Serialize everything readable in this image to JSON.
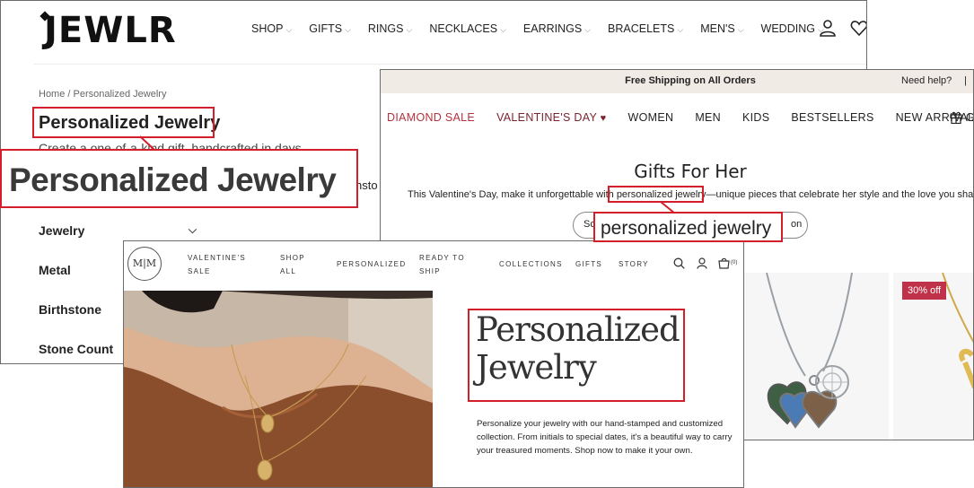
{
  "jewlr": {
    "logo": "JEWLR",
    "nav": [
      "SHOP",
      "GIFTS",
      "RINGS",
      "NECKLACES",
      "EARRINGS",
      "BRACELETS",
      "MEN'S",
      "WEDDING"
    ],
    "breadcrumb": "Home / Personalized Jewelry",
    "title": "Personalized Jewelry",
    "subtitle": "Create a one-of-a-kind gift, handcrafted in days",
    "button_fragment": "hsto",
    "filters": [
      "Jewelry",
      "Metal",
      "Birthstone",
      "Stone Count"
    ],
    "zoom_text": "Personalized Jewelry"
  },
  "gifts_site": {
    "shipping": "Free Shipping on All Orders",
    "help": "Need help?",
    "help_sep": "|",
    "nav": [
      "DIAMOND SALE",
      "VALENTINE'S DAY",
      "WOMEN",
      "MEN",
      "KIDS",
      "BESTSELLERS",
      "NEW ARRIVALS"
    ],
    "nav_fragment": "G",
    "heart": "♥",
    "title": "Gifts For Her",
    "desc_before": "This Valentine's Day, make it unforgettable with ",
    "desc_highlight": "personalized jewelry",
    "desc_after": "—unique pieces that celebrate her style and the love you share.",
    "button_left_fragment": "Sc",
    "button_right_fragment": "on",
    "badge": "30% off",
    "zoom_text": "personalized jewelry"
  },
  "mm_site": {
    "logo": "M|M",
    "nav": [
      {
        "line1": "VALENTINE'S",
        "line2": "SALE"
      },
      {
        "line1": "SHOP",
        "line2": "ALL"
      },
      {
        "line1": "PERSONALIZED",
        "line2": ""
      },
      {
        "line1": "READY TO",
        "line2": "SHIP"
      },
      {
        "line1": "COLLECTIONS",
        "line2": ""
      },
      {
        "line1": "GIFTS",
        "line2": ""
      },
      {
        "line1": "STORY",
        "line2": ""
      }
    ],
    "cart_count": "(0)",
    "title_line1": "Personalized",
    "title_line2": "Jewelry",
    "description": "Personalize your jewelry with our hand-stamped and customized collection. From initials to special dates, it's a beautiful way to carry your treasured moments. Shop now to make it your own."
  },
  "colors": {
    "highlight": "#d21f2a",
    "sale": "#b2323e",
    "badge": "#c0324a",
    "topbar": "#f1ebe6"
  }
}
